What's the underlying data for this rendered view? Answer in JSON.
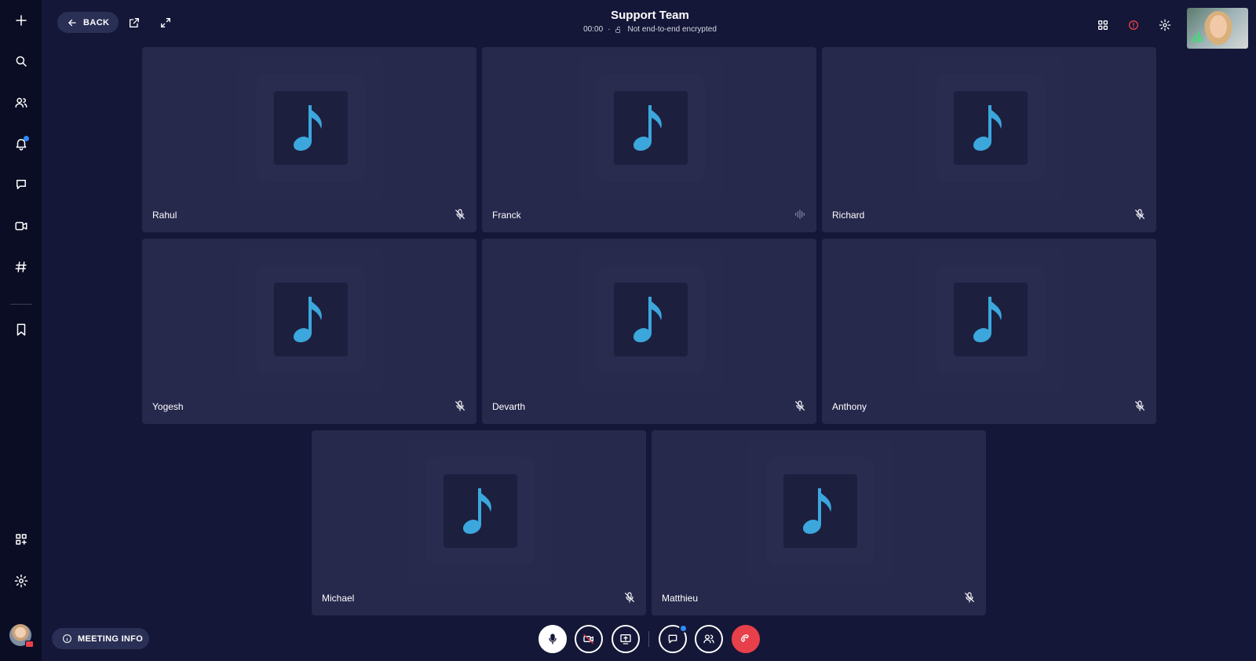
{
  "header": {
    "back_label": "BACK",
    "title": "Support Team",
    "timer": "00:00",
    "separator": "·",
    "encryption": "Not end-to-end encrypted"
  },
  "participants": [
    {
      "name": "Rahul",
      "status": "muted"
    },
    {
      "name": "Franck",
      "status": "speaking"
    },
    {
      "name": "Richard",
      "status": "muted"
    },
    {
      "name": "Yogesh",
      "status": "muted"
    },
    {
      "name": "Devarth",
      "status": "muted"
    },
    {
      "name": "Anthony",
      "status": "muted"
    },
    {
      "name": "Michael",
      "status": "muted"
    },
    {
      "name": "Matthieu",
      "status": "muted"
    }
  ],
  "footer": {
    "meeting_info_label": "MEETING INFO"
  },
  "icons": {
    "rail": [
      "plus-icon",
      "search-icon",
      "contacts-icon",
      "bell-icon",
      "chat-icon",
      "video-icon",
      "hashtag-icon",
      "bookmark-icon",
      "apps-icon",
      "gear-icon"
    ],
    "tile_art": "music-note-icon",
    "controls": [
      "microphone-icon",
      "camera-off-icon",
      "share-screen-icon",
      "chat-icon",
      "participants-icon",
      "hang-up-icon"
    ]
  },
  "colors": {
    "background": "#141737",
    "rail": "#0b0d24",
    "tile": "#26284c",
    "note": "#3ba7dc",
    "accent_blue": "#2d8cff",
    "danger": "#e8404a"
  }
}
